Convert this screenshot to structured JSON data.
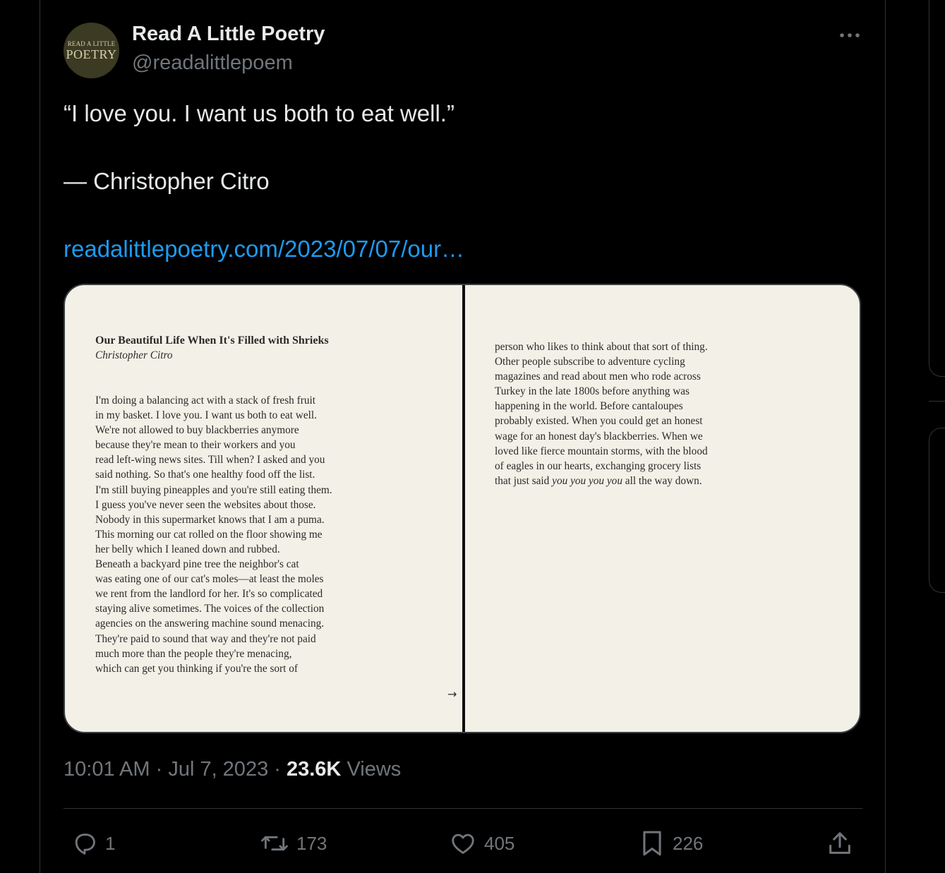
{
  "author": {
    "avatar_line1": "READ A LITTLE",
    "avatar_line2": "POETRY",
    "display_name": "Read A Little Poetry",
    "handle": "@readalittlepoem"
  },
  "tweet": {
    "quote": "“I love you. I want us both to eat well.”",
    "attribution": "— Christopher Citro",
    "link": "readalittlepoetry.com/2023/07/07/our…"
  },
  "media": {
    "title": "Our Beautiful Life When It's Filled with Shrieks",
    "author": "Christopher Citro",
    "left_lines": [
      "I'm doing a balancing act with a stack of fresh fruit",
      "in my basket. I love you. I want us both to eat well.",
      "We're not allowed to buy blackberries anymore",
      "because they're mean to their workers and you",
      "read left-wing news sites. Till when? I asked and you",
      "said nothing. So that's one healthy food off the list.",
      "I'm still buying pineapples and you're still eating them.",
      "I guess you've never seen the websites about those.",
      "Nobody in this supermarket knows that I am a puma.",
      "This morning our cat rolled on the floor showing me",
      "her belly which I leaned down and rubbed.",
      "Beneath a backyard pine tree the neighbor's cat",
      "was eating one of our cat's moles—at least the moles",
      "we rent from the landlord for her. It's so complicated",
      "staying alive sometimes. The voices of the collection",
      "agencies on the answering machine sound menacing.",
      "They're paid to sound that way and they're not paid",
      "much more than the people they're menacing,",
      "which can get you thinking if you're the sort of"
    ],
    "right_lines": [
      "person who likes to think about that sort of thing.",
      "Other people subscribe to adventure cycling",
      "magazines and read about men who rode across",
      "Turkey in the late 1800s before anything was",
      "happening in the world. Before cantaloupes",
      "probably existed. When you could get an honest",
      "wage for an honest day's blackberries. When we",
      "loved like fierce mountain storms, with the blood",
      "of eagles in our hearts, exchanging grocery lists"
    ],
    "last_line_start": "that just said ",
    "last_line_italic": "you you you you",
    "last_line_end": " all the way down.",
    "arrow": "→"
  },
  "meta": {
    "time": "10:01 AM",
    "date": "Jul 7, 2023",
    "views_count": "23.6K",
    "views_label": "Views"
  },
  "actions": {
    "replies": "1",
    "reposts": "173",
    "likes": "405",
    "bookmarks": "226"
  },
  "colors": {
    "background": "#000000",
    "text": "#e7e9ea",
    "secondary_text": "#71767b",
    "link": "#1d9bf0",
    "border": "#2f3336",
    "page_paper": "#f3f1e7"
  }
}
